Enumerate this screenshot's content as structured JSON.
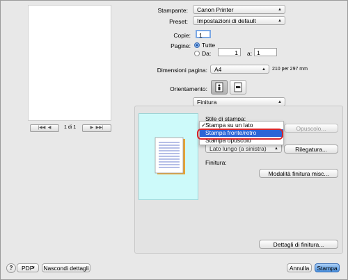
{
  "preview": {
    "page_indicator": "1 di 1"
  },
  "form": {
    "printer_label": "Stampante:",
    "printer_value": "Canon Printer",
    "preset_label": "Preset:",
    "preset_value": "Impostazioni di default",
    "copies_label": "Copie:",
    "copies_value": "1",
    "pages_label": "Pagine:",
    "pages_all": "Tutte",
    "pages_from": "Da:",
    "pages_from_value": "1",
    "pages_to": "a:",
    "pages_to_value": "1",
    "paper_label": "Dimensioni pagina:",
    "paper_value": "A4",
    "paper_size_text": "210 per 297 mm",
    "orientation_label": "Orientamento:",
    "panel_value": "Finitura"
  },
  "finishing": {
    "print_style_label": "Stile di stampa:",
    "print_style_value": "Stampa su un lato",
    "menu_items": [
      "Stampa su un lato",
      "Stampa fronte/retro",
      "Stampa opuscolo"
    ],
    "binding_value": "Lato lungo (a sinistra)",
    "booklet_button": "Opuscolo...",
    "binding_button": "Rilegatura...",
    "finishing_label": "Finitura:",
    "finishing_mode_button": "Modalità finitura misc...",
    "details_button": "Dettagli di finitura..."
  },
  "footer": {
    "help": "?",
    "pdf": "PDF",
    "hide_details": "Nascondi dettagli",
    "cancel": "Annulla",
    "print": "Stampa"
  },
  "colors": {
    "accent": "#2c65d6",
    "highlight_ring": "#d8262b",
    "preview_bg": "#cdfafa"
  }
}
